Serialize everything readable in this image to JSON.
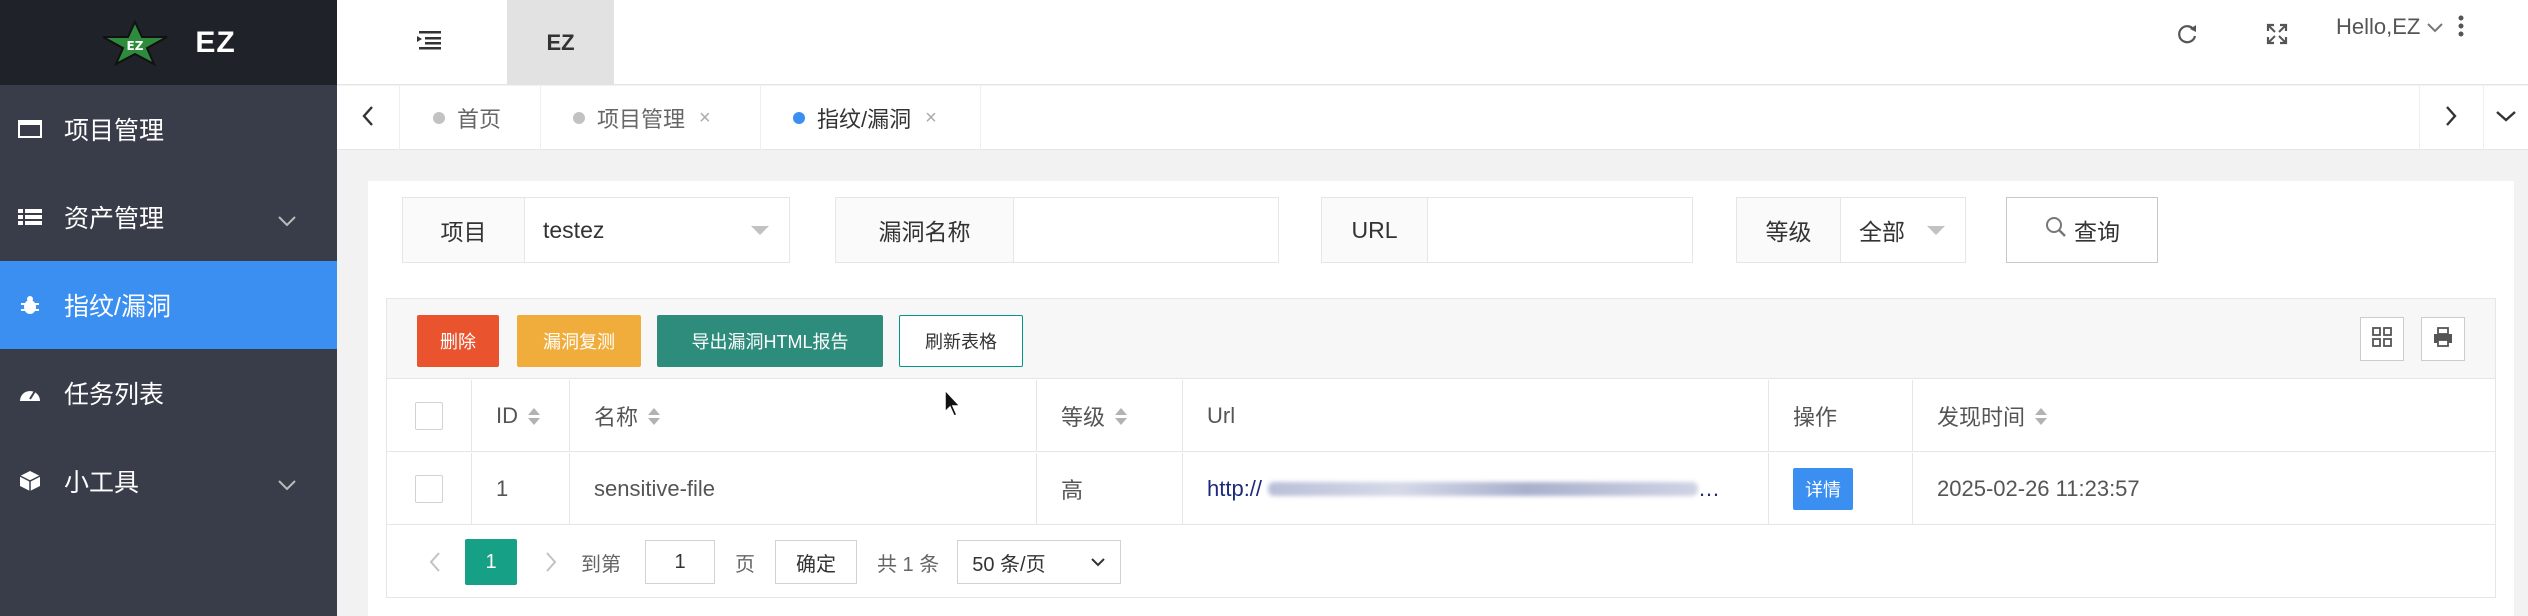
{
  "app": {
    "title": "EZ"
  },
  "sidebar": {
    "items": [
      {
        "label": "项目管理",
        "icon": "window-icon",
        "active": false,
        "has_children": false
      },
      {
        "label": "资产管理",
        "icon": "list-icon",
        "active": false,
        "has_children": true
      },
      {
        "label": "指纹/漏洞",
        "icon": "bug-icon",
        "active": true,
        "has_children": false
      },
      {
        "label": "任务列表",
        "icon": "dashboard-icon",
        "active": false,
        "has_children": false
      },
      {
        "label": "小工具",
        "icon": "cube-icon",
        "active": false,
        "has_children": true
      }
    ]
  },
  "header": {
    "tab_label": "EZ",
    "user_label": "Hello,EZ"
  },
  "tabs": [
    {
      "label": "首页",
      "active": false,
      "closable": false
    },
    {
      "label": "项目管理",
      "active": false,
      "closable": true
    },
    {
      "label": "指纹/漏洞",
      "active": true,
      "closable": true
    }
  ],
  "filters": {
    "project": {
      "label": "项目",
      "value": "testez"
    },
    "vuln_name": {
      "label": "漏洞名称",
      "value": ""
    },
    "url": {
      "label": "URL",
      "value": ""
    },
    "level": {
      "label": "等级",
      "value": "全部"
    },
    "search_label": "查询"
  },
  "toolbar": {
    "delete_label": "删除",
    "recheck_label": "漏洞复测",
    "export_label": "导出漏洞HTML报告",
    "refresh_label": "刷新表格"
  },
  "table": {
    "columns": [
      "ID",
      "名称",
      "等级",
      "Url",
      "操作",
      "发现时间"
    ],
    "rows": [
      {
        "id": "1",
        "name": "sensitive-file",
        "level": "高",
        "url": "http://",
        "action": "详情",
        "found_time": "2025-02-26 11:23:57"
      }
    ]
  },
  "pager": {
    "current_page": "1",
    "goto_label": "到第",
    "goto_value": "1",
    "page_unit": "页",
    "confirm_label": "确定",
    "total_label": "共 1 条",
    "page_size_label": "50 条/页"
  },
  "colors": {
    "sidebar_bg": "#393d49",
    "accent_blue": "#3a8ff0",
    "danger": "#e9532e",
    "warning": "#f0ad3c",
    "teal": "#2d8c7c",
    "pager_green": "#16a085"
  }
}
